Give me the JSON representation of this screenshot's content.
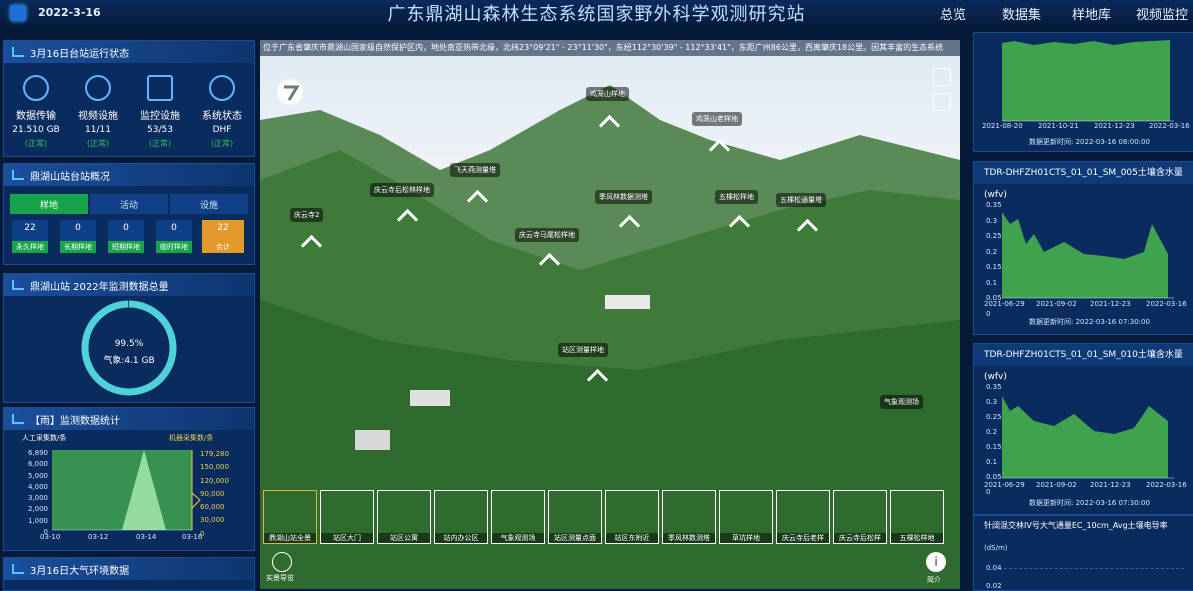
{
  "header": {
    "date": "2022-3-16",
    "title": "广东鼎湖山森林生态系统国家野外科学观测研究站",
    "nav": [
      "总览",
      "数据集",
      "样地库",
      "视频监控"
    ]
  },
  "status_panel": {
    "title": "3月16日台站运行状态",
    "items": [
      {
        "label": "数据传输",
        "value": "21.510 GB",
        "status": "(正常)",
        "icon": "cloud-icon"
      },
      {
        "label": "视频设施",
        "value": "11/11",
        "status": "(正常)",
        "icon": "video-icon"
      },
      {
        "label": "监控设施",
        "value": "53/53",
        "status": "(正常)",
        "icon": "monitor-icon"
      },
      {
        "label": "系统状态",
        "value": "DHF",
        "status": "(正常)",
        "icon": "system-icon"
      }
    ]
  },
  "overview_panel": {
    "title": "鼎湖山站台站概况",
    "tabs": [
      "样地",
      "活动",
      "设施"
    ],
    "counts": [
      {
        "value": "22",
        "label": "永久样地"
      },
      {
        "value": "0",
        "label": "长期样地"
      },
      {
        "value": "0",
        "label": "短期样地"
      },
      {
        "value": "0",
        "label": "临时样地"
      },
      {
        "value": "22",
        "label": "合计"
      }
    ]
  },
  "donut_panel": {
    "title": "鼎湖山站 2022年监测数据总量",
    "percent": "99.5%",
    "percent_value": 99.5,
    "label": "气象:4.1 GB"
  },
  "rain_panel": {
    "title": "【雨】监测数据统计",
    "left_axis_title": "人工采集数/条",
    "right_axis_title": "机器采集数/条",
    "left_ticks": [
      "6,890",
      "6,000",
      "5,000",
      "4,000",
      "3,000",
      "2,000",
      "1,000",
      "0"
    ],
    "right_ticks": [
      "179,280",
      "150,000",
      "120,000",
      "90,000",
      "60,000",
      "30,000",
      "0"
    ],
    "x_ticks": [
      "03-10",
      "03-12",
      "03-14",
      "03-16"
    ]
  },
  "air_panel": {
    "title": "3月16日大气环境数据"
  },
  "panorama": {
    "marquee": "位于广东省肇庆市鼎湖山国家级自然保护区内，地处南亚热带北缘，北纬23°09'21\" - 23°11'30\"，东经112°30'39\" - 112°33'41\"，东距广州86公里，西离肇庆18公里。因其丰富的生态系统",
    "labels": [
      "鸡笼山样地",
      "鸡笼山老样地",
      "飞天燕测量塔",
      "庆云寺后松林样地",
      "季风林数据测塔",
      "五棵松样地",
      "五棵松通量塔",
      "庆云寺2",
      "庆云寺马尾松样地",
      "站区测量样地",
      "气象观测场"
    ],
    "thumbs": [
      "鼎湖山站全景",
      "站区大门",
      "站区公寓",
      "站内办公区",
      "气象观测场",
      "站区测量点面",
      "站区东附近",
      "季风林数测塔",
      "草坑样地",
      "庆云寺后老样",
      "庆云寺后松样",
      "五棵松样地"
    ],
    "corner_label": "实景导览",
    "info_label": "简介"
  },
  "right_panels": [
    {
      "title": "",
      "x_ticks": [
        "2021-08-20",
        "2021-10-21",
        "2021-12-23",
        "2022-03-16"
      ],
      "update": "数据更新时间: 2022-03-16 08:00:00"
    },
    {
      "title": "TDR-DHFZH01CTS_01_01_SM_005土壤含水量(wfv)",
      "y_ticks": [
        "0.35",
        "0.3",
        "0.25",
        "0.2",
        "0.15",
        "0.1",
        "0.05",
        "0"
      ],
      "x_ticks": [
        "2021-06-29",
        "2021-09-02",
        "2021-12-23",
        "2022-03-16"
      ],
      "update": "数据更新时间: 2022-03-16 07:30:00"
    },
    {
      "title": "TDR-DHFZH01CTS_01_01_SM_010土壤含水量(wfv)",
      "y_ticks": [
        "0.35",
        "0.3",
        "0.25",
        "0.2",
        "0.15",
        "0.1",
        "0.05",
        "0"
      ],
      "x_ticks": [
        "2021-06-29",
        "2021-09-02",
        "2021-12-23",
        "2022-03-16"
      ],
      "update": "数据更新时间: 2022-03-16 07:30:00"
    },
    {
      "title": "针阔混交林IV号大气通量EC_10cm_Avg土壤电导率",
      "unit": "(dS/m)",
      "y_ticks": [
        "0.04",
        "0.02"
      ]
    }
  ],
  "colors": {
    "accent": "#27c35b",
    "panel": "#0a2b5e",
    "chart_fill": "#3fa34d",
    "orange": "#e39a2b"
  }
}
